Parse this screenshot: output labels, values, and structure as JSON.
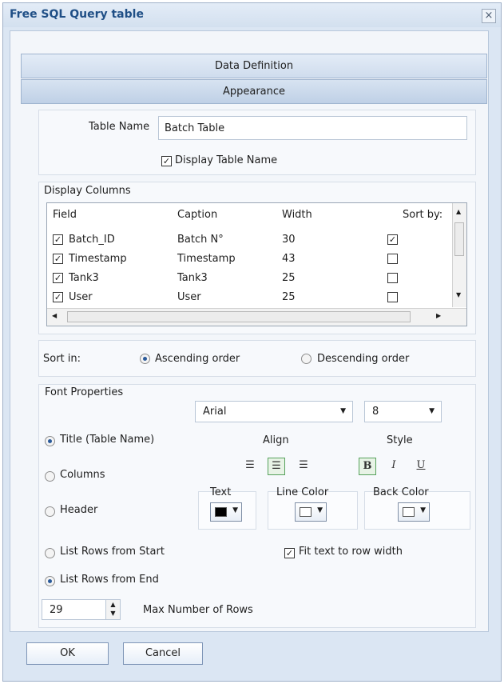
{
  "window": {
    "title": "Free SQL Query table",
    "close_icon": "close-icon"
  },
  "tabs": [
    {
      "label": "Data Definition"
    },
    {
      "label": "Appearance"
    }
  ],
  "table_name": {
    "label": "Table Name",
    "value": "Batch Table",
    "display_checkbox": {
      "label": "Display Table Name",
      "checked": true
    }
  },
  "display_columns": {
    "legend": "Display Columns",
    "headers": [
      "Field",
      "Caption",
      "Width",
      "Sort by:"
    ],
    "rows": [
      {
        "enabled": true,
        "field": "Batch_ID",
        "caption": "Batch N°",
        "width": "30",
        "sort": true
      },
      {
        "enabled": true,
        "field": "Timestamp",
        "caption": "Timestamp",
        "width": "43",
        "sort": false
      },
      {
        "enabled": true,
        "field": "Tank3",
        "caption": "Tank3",
        "width": "25",
        "sort": false
      },
      {
        "enabled": true,
        "field": "User",
        "caption": "User",
        "width": "25",
        "sort": false
      }
    ]
  },
  "sort": {
    "label": "Sort in:",
    "ascending": "Ascending order",
    "descending": "Descending order",
    "selected": "ascending"
  },
  "font": {
    "legend": "Font Properties",
    "family": "Arial",
    "size": "8",
    "targets": {
      "title": "Title (Table Name)",
      "columns": "Columns",
      "header": "Header",
      "selected": "title"
    },
    "align_label": "Align",
    "style_label": "Style",
    "align_selected": "center",
    "style_bold": "B",
    "style_italic": "I",
    "style_underline": "U",
    "text_color_label": "Text",
    "line_color_label": "Line Color",
    "back_color_label": "Back Color",
    "text_color": "#000000",
    "line_color": "#ffffff",
    "back_color": "#ffffff"
  },
  "rows": {
    "from_start": "List Rows from Start",
    "from_end": "List Rows from End",
    "selected": "from_end",
    "fit_text": "Fit text to row width",
    "fit_checked": true,
    "max_rows_value": "29",
    "max_rows_label": "Max Number of Rows"
  },
  "buttons": {
    "ok": "OK",
    "cancel": "Cancel"
  }
}
